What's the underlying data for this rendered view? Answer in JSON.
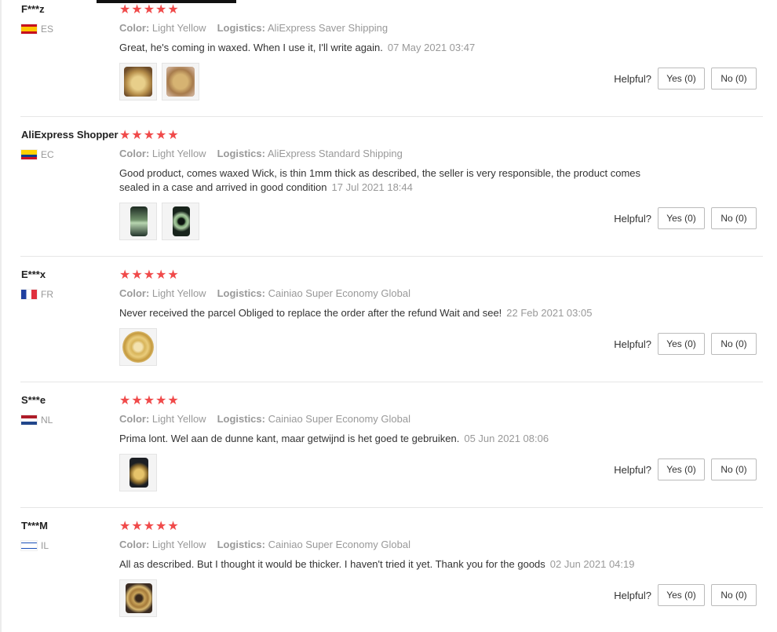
{
  "labels": {
    "color": "Color:",
    "logistics": "Logistics:",
    "helpful": "Helpful?"
  },
  "reviews": [
    {
      "user": "F***z",
      "country": "ES",
      "stars": "★★★★★",
      "color": "Light Yellow",
      "logistics": "AliExpress Saver Shipping",
      "text": "Great, he's coming in waxed. When I use it, I'll write again.",
      "date": "07 May 2021 03:47",
      "yes": "Yes (0)",
      "no": "No (0)"
    },
    {
      "user": "AliExpress Shopper",
      "country": "EC",
      "stars": "★★★★★",
      "color": "Light Yellow",
      "logistics": "AliExpress Standard Shipping",
      "text": "Good product, comes waxed Wick, is thin 1mm thick as described, the seller is very responsible, the product comes sealed in a case and arrived in good condition",
      "date": "17 Jul 2021 18:44",
      "yes": "Yes (0)",
      "no": "No (0)"
    },
    {
      "user": "E***x",
      "country": "FR",
      "stars": "★★★★★",
      "color": "Light Yellow",
      "logistics": "Cainiao Super Economy Global",
      "text": "Never received the parcel Obliged to replace the order after the refund Wait and see!",
      "date": "22 Feb 2021 03:05",
      "yes": "Yes (0)",
      "no": "No (0)"
    },
    {
      "user": "S***e",
      "country": "NL",
      "stars": "★★★★★",
      "color": "Light Yellow",
      "logistics": "Cainiao Super Economy Global",
      "text": "Prima lont. Wel aan de dunne kant, maar getwijnd is het goed te gebruiken.",
      "date": "05 Jun 2021 08:06",
      "yes": "Yes (0)",
      "no": "No (0)"
    },
    {
      "user": "T***M",
      "country": "IL",
      "stars": "★★★★★",
      "color": "Light Yellow",
      "logistics": "Cainiao Super Economy Global",
      "text": "All as described. But I thought it would be thicker. I haven't tried it yet. Thank you for the goods",
      "date": "02 Jun 2021 04:19",
      "yes": "Yes (0)",
      "no": "No (0)"
    }
  ]
}
